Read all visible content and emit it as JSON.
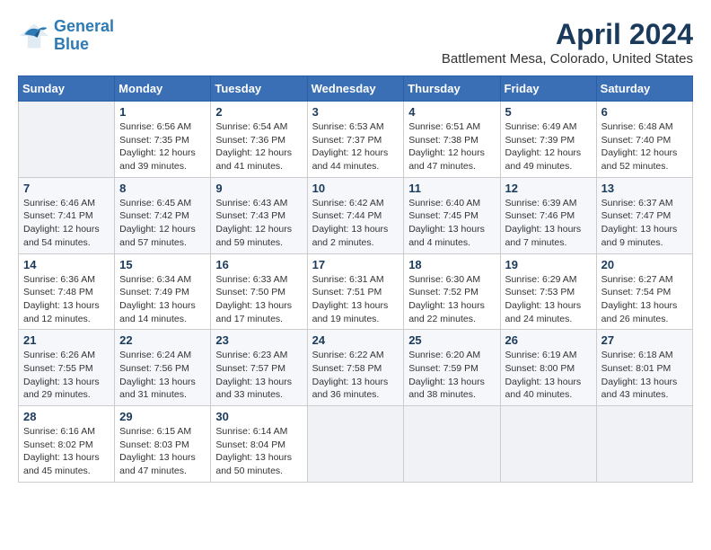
{
  "header": {
    "logo_line1": "General",
    "logo_line2": "Blue",
    "title": "April 2024",
    "subtitle": "Battlement Mesa, Colorado, United States"
  },
  "days_of_week": [
    "Sunday",
    "Monday",
    "Tuesday",
    "Wednesday",
    "Thursday",
    "Friday",
    "Saturday"
  ],
  "weeks": [
    [
      {
        "day": "",
        "info": ""
      },
      {
        "day": "1",
        "info": "Sunrise: 6:56 AM\nSunset: 7:35 PM\nDaylight: 12 hours\nand 39 minutes."
      },
      {
        "day": "2",
        "info": "Sunrise: 6:54 AM\nSunset: 7:36 PM\nDaylight: 12 hours\nand 41 minutes."
      },
      {
        "day": "3",
        "info": "Sunrise: 6:53 AM\nSunset: 7:37 PM\nDaylight: 12 hours\nand 44 minutes."
      },
      {
        "day": "4",
        "info": "Sunrise: 6:51 AM\nSunset: 7:38 PM\nDaylight: 12 hours\nand 47 minutes."
      },
      {
        "day": "5",
        "info": "Sunrise: 6:49 AM\nSunset: 7:39 PM\nDaylight: 12 hours\nand 49 minutes."
      },
      {
        "day": "6",
        "info": "Sunrise: 6:48 AM\nSunset: 7:40 PM\nDaylight: 12 hours\nand 52 minutes."
      }
    ],
    [
      {
        "day": "7",
        "info": "Sunrise: 6:46 AM\nSunset: 7:41 PM\nDaylight: 12 hours\nand 54 minutes."
      },
      {
        "day": "8",
        "info": "Sunrise: 6:45 AM\nSunset: 7:42 PM\nDaylight: 12 hours\nand 57 minutes."
      },
      {
        "day": "9",
        "info": "Sunrise: 6:43 AM\nSunset: 7:43 PM\nDaylight: 12 hours\nand 59 minutes."
      },
      {
        "day": "10",
        "info": "Sunrise: 6:42 AM\nSunset: 7:44 PM\nDaylight: 13 hours\nand 2 minutes."
      },
      {
        "day": "11",
        "info": "Sunrise: 6:40 AM\nSunset: 7:45 PM\nDaylight: 13 hours\nand 4 minutes."
      },
      {
        "day": "12",
        "info": "Sunrise: 6:39 AM\nSunset: 7:46 PM\nDaylight: 13 hours\nand 7 minutes."
      },
      {
        "day": "13",
        "info": "Sunrise: 6:37 AM\nSunset: 7:47 PM\nDaylight: 13 hours\nand 9 minutes."
      }
    ],
    [
      {
        "day": "14",
        "info": "Sunrise: 6:36 AM\nSunset: 7:48 PM\nDaylight: 13 hours\nand 12 minutes."
      },
      {
        "day": "15",
        "info": "Sunrise: 6:34 AM\nSunset: 7:49 PM\nDaylight: 13 hours\nand 14 minutes."
      },
      {
        "day": "16",
        "info": "Sunrise: 6:33 AM\nSunset: 7:50 PM\nDaylight: 13 hours\nand 17 minutes."
      },
      {
        "day": "17",
        "info": "Sunrise: 6:31 AM\nSunset: 7:51 PM\nDaylight: 13 hours\nand 19 minutes."
      },
      {
        "day": "18",
        "info": "Sunrise: 6:30 AM\nSunset: 7:52 PM\nDaylight: 13 hours\nand 22 minutes."
      },
      {
        "day": "19",
        "info": "Sunrise: 6:29 AM\nSunset: 7:53 PM\nDaylight: 13 hours\nand 24 minutes."
      },
      {
        "day": "20",
        "info": "Sunrise: 6:27 AM\nSunset: 7:54 PM\nDaylight: 13 hours\nand 26 minutes."
      }
    ],
    [
      {
        "day": "21",
        "info": "Sunrise: 6:26 AM\nSunset: 7:55 PM\nDaylight: 13 hours\nand 29 minutes."
      },
      {
        "day": "22",
        "info": "Sunrise: 6:24 AM\nSunset: 7:56 PM\nDaylight: 13 hours\nand 31 minutes."
      },
      {
        "day": "23",
        "info": "Sunrise: 6:23 AM\nSunset: 7:57 PM\nDaylight: 13 hours\nand 33 minutes."
      },
      {
        "day": "24",
        "info": "Sunrise: 6:22 AM\nSunset: 7:58 PM\nDaylight: 13 hours\nand 36 minutes."
      },
      {
        "day": "25",
        "info": "Sunrise: 6:20 AM\nSunset: 7:59 PM\nDaylight: 13 hours\nand 38 minutes."
      },
      {
        "day": "26",
        "info": "Sunrise: 6:19 AM\nSunset: 8:00 PM\nDaylight: 13 hours\nand 40 minutes."
      },
      {
        "day": "27",
        "info": "Sunrise: 6:18 AM\nSunset: 8:01 PM\nDaylight: 13 hours\nand 43 minutes."
      }
    ],
    [
      {
        "day": "28",
        "info": "Sunrise: 6:16 AM\nSunset: 8:02 PM\nDaylight: 13 hours\nand 45 minutes."
      },
      {
        "day": "29",
        "info": "Sunrise: 6:15 AM\nSunset: 8:03 PM\nDaylight: 13 hours\nand 47 minutes."
      },
      {
        "day": "30",
        "info": "Sunrise: 6:14 AM\nSunset: 8:04 PM\nDaylight: 13 hours\nand 50 minutes."
      },
      {
        "day": "",
        "info": ""
      },
      {
        "day": "",
        "info": ""
      },
      {
        "day": "",
        "info": ""
      },
      {
        "day": "",
        "info": ""
      }
    ]
  ]
}
